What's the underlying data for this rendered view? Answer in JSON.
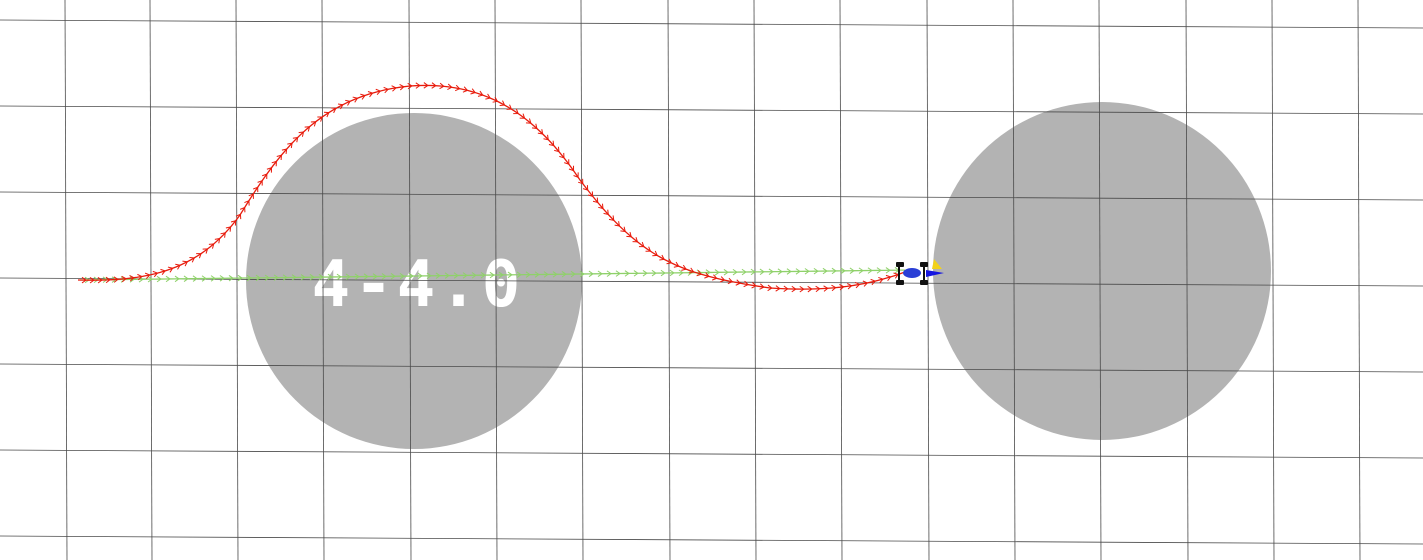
{
  "viewer": {
    "background_color": "#ffffff",
    "grid_color": "#4a4a4a",
    "obstacle_color": "#b3b3b3",
    "obstacle_label_color": "#ffffff",
    "planned_path_color": "#e81b0c",
    "reference_path_color": "#8fd16a",
    "robot_body_color": "#2a3fd6",
    "robot_wheel_color": "#111111",
    "robot_heading_color": "#1515e0",
    "goal_marker_color": "#f2d21a"
  },
  "obstacles": [
    {
      "name": "obstacle-1",
      "label": "4-4.0"
    },
    {
      "name": "obstacle-2",
      "label": ""
    }
  ],
  "robot": {
    "icon": "robot-car-icon"
  }
}
